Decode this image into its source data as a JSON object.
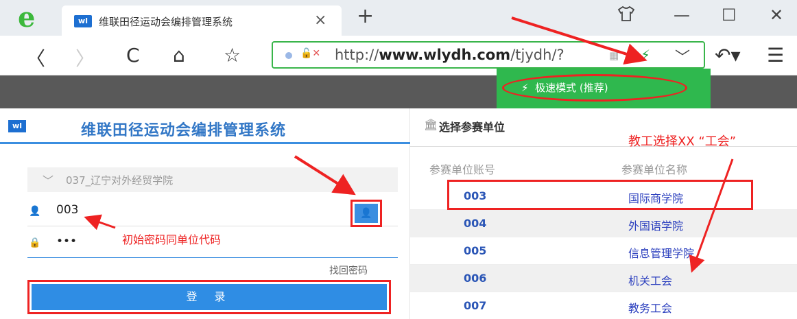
{
  "browser": {
    "tab_title": "维联田径运动会编排管理系统",
    "tab_favicon": "wl",
    "url_prefix": "http://",
    "url_domain": "www.wlydh.com",
    "url_path": "/tjydh/?",
    "speed_mode": "极速模式 (推荐)"
  },
  "login": {
    "logo": "wl",
    "title": "维联田径运动会编排管理系统",
    "school": "037_辽宁对外经贸学院",
    "username": "003",
    "password": "•••",
    "forgot": "找回密码",
    "submit": "登 录",
    "note": "初始密码同单位代码"
  },
  "units": {
    "title": "选择参赛单位",
    "note": "教工选择XX “工会”",
    "col_code": "参赛单位账号",
    "col_name": "参赛单位名称",
    "rows": [
      {
        "code": "003",
        "name": "国际商学院"
      },
      {
        "code": "004",
        "name": "外国语学院"
      },
      {
        "code": "005",
        "name": "信息管理学院"
      },
      {
        "code": "006",
        "name": "机关工会"
      },
      {
        "code": "007",
        "name": "教务工会"
      }
    ]
  },
  "colors": {
    "accent": "#2f8de4",
    "annotation": "#e22222",
    "speed_green": "#2fb84e"
  }
}
